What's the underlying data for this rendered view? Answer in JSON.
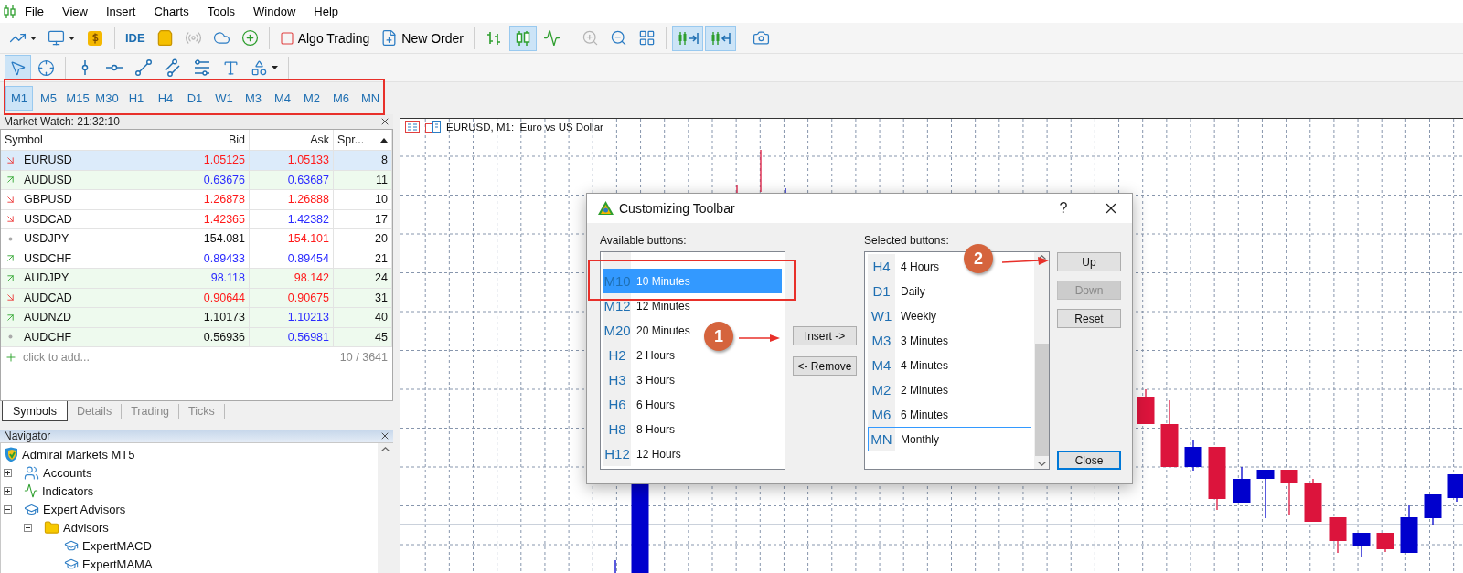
{
  "menu": [
    "File",
    "View",
    "Insert",
    "Charts",
    "Tools",
    "Window",
    "Help"
  ],
  "main_toolbar": {
    "ide": "IDE",
    "algo_trading": "Algo Trading",
    "new_order": "New Order",
    "signals_disabled": true,
    "bar_chart_selected": false,
    "candle_chart_selected": true,
    "line_chart_selected": false,
    "zoom_in_disabled": true,
    "chart_shift_on": true,
    "autoscroll_on": true
  },
  "drawing_toolbar": {
    "cursor_selected": true,
    "crosshair_selected": false
  },
  "timeframes": [
    {
      "label": "M1",
      "selected": true
    },
    {
      "label": "M5",
      "selected": false
    },
    {
      "label": "M15",
      "selected": false
    },
    {
      "label": "M30",
      "selected": false
    },
    {
      "label": "H1",
      "selected": false
    },
    {
      "label": "H4",
      "selected": false
    },
    {
      "label": "D1",
      "selected": false
    },
    {
      "label": "W1",
      "selected": false
    },
    {
      "label": "M3",
      "selected": false
    },
    {
      "label": "M4",
      "selected": false
    },
    {
      "label": "M2",
      "selected": false
    },
    {
      "label": "M6",
      "selected": false
    },
    {
      "label": "MN",
      "selected": false
    }
  ],
  "market_watch": {
    "title": "Market Watch: 21:32:10",
    "columns": [
      "Symbol",
      "Bid",
      "Ask",
      "Spr..."
    ],
    "rows": [
      {
        "kind": "down",
        "symbol": "EURUSD",
        "bid": {
          "value": "1.05125",
          "color": "#ff1a1a"
        },
        "ask": {
          "value": "1.05133",
          "color": "#ff1a1a"
        },
        "spread": "8",
        "selected": true
      },
      {
        "kind": "up",
        "symbol": "AUDUSD",
        "bid": {
          "value": "0.63676",
          "color": "#2b2bff"
        },
        "ask": {
          "value": "0.63687",
          "color": "#2b2bff"
        },
        "spread": "11",
        "selected": false,
        "shaded": true
      },
      {
        "kind": "down",
        "symbol": "GBPUSD",
        "bid": {
          "value": "1.26878",
          "color": "#ff1a1a"
        },
        "ask": {
          "value": "1.26888",
          "color": "#ff1a1a"
        },
        "spread": "10",
        "selected": false,
        "shaded": false
      },
      {
        "kind": "down",
        "symbol": "USDCAD",
        "bid": {
          "value": "1.42365",
          "color": "#ff1a1a"
        },
        "ask": {
          "value": "1.42382",
          "color": "#2b2bff"
        },
        "spread": "17",
        "selected": false,
        "shaded": false
      },
      {
        "kind": "flat",
        "symbol": "USDJPY",
        "bid": {
          "value": "154.081",
          "color": "#111111"
        },
        "ask": {
          "value": "154.101",
          "color": "#ff1a1a"
        },
        "spread": "20",
        "selected": false,
        "shaded": false
      },
      {
        "kind": "up",
        "symbol": "USDCHF",
        "bid": {
          "value": "0.89433",
          "color": "#2b2bff"
        },
        "ask": {
          "value": "0.89454",
          "color": "#2b2bff"
        },
        "spread": "21",
        "selected": false,
        "shaded": false
      },
      {
        "kind": "up",
        "symbol": "AUDJPY",
        "bid": {
          "value": "98.118",
          "color": "#2b2bff"
        },
        "ask": {
          "value": "98.142",
          "color": "#ff1a1a"
        },
        "spread": "24",
        "selected": false,
        "shaded": true
      },
      {
        "kind": "down",
        "symbol": "AUDCAD",
        "bid": {
          "value": "0.90644",
          "color": "#ff1a1a"
        },
        "ask": {
          "value": "0.90675",
          "color": "#ff1a1a"
        },
        "spread": "31",
        "selected": false,
        "shaded": true
      },
      {
        "kind": "up",
        "symbol": "AUDNZD",
        "bid": {
          "value": "1.10173",
          "color": "#111111"
        },
        "ask": {
          "value": "1.10213",
          "color": "#2b2bff"
        },
        "spread": "40",
        "selected": false,
        "shaded": true
      },
      {
        "kind": "flat",
        "symbol": "AUDCHF",
        "bid": {
          "value": "0.56936",
          "color": "#111111"
        },
        "ask": {
          "value": "0.56981",
          "color": "#2b2bff"
        },
        "spread": "45",
        "selected": false,
        "shaded": true
      }
    ],
    "add_row": "click to add...",
    "count": "10 / 3641",
    "tabs": [
      {
        "label": "Symbols",
        "selected": true
      },
      {
        "label": "Details",
        "selected": false
      },
      {
        "label": "Trading",
        "selected": false
      },
      {
        "label": "Ticks",
        "selected": false
      }
    ]
  },
  "navigator": {
    "title": "Navigator",
    "tree": [
      {
        "label": "Admiral Markets MT5",
        "kind": "root",
        "children": [
          {
            "label": "Accounts",
            "kind": "accounts",
            "expanded": false
          },
          {
            "label": "Indicators",
            "kind": "indicators",
            "expanded": false
          },
          {
            "label": "Expert Advisors",
            "kind": "experts",
            "expanded": true,
            "children": [
              {
                "label": "Advisors",
                "kind": "folder",
                "expanded": true,
                "children": [
                  {
                    "label": "ExpertMACD",
                    "kind": "expert"
                  },
                  {
                    "label": "ExpertMAMA",
                    "kind": "expert"
                  }
                ]
              }
            ]
          }
        ]
      }
    ]
  },
  "chart": {
    "title": "EURUSD, M1:  Euro vs US Dollar"
  },
  "dialog": {
    "title": "Customizing Toolbar",
    "help": "?",
    "available_label": "Available buttons:",
    "selected_label": "Selected buttons:",
    "available": [
      {
        "code": "M10",
        "label": "10 Minutes",
        "selected": true
      },
      {
        "code": "M12",
        "label": "12 Minutes",
        "selected": false
      },
      {
        "code": "M20",
        "label": "20 Minutes",
        "selected": false
      },
      {
        "code": "H2",
        "label": "2 Hours",
        "selected": false
      },
      {
        "code": "H3",
        "label": "3 Hours",
        "selected": false
      },
      {
        "code": "H6",
        "label": "6 Hours",
        "selected": false
      },
      {
        "code": "H8",
        "label": "8 Hours",
        "selected": false
      },
      {
        "code": "H12",
        "label": "12 Hours",
        "selected": false
      }
    ],
    "chosen": [
      {
        "code": "H4",
        "label": "4 Hours",
        "selected": false
      },
      {
        "code": "D1",
        "label": "Daily",
        "selected": false
      },
      {
        "code": "W1",
        "label": "Weekly",
        "selected": false
      },
      {
        "code": "M3",
        "label": "3 Minutes",
        "selected": false
      },
      {
        "code": "M4",
        "label": "4 Minutes",
        "selected": false
      },
      {
        "code": "M2",
        "label": "2 Minutes",
        "selected": false
      },
      {
        "code": "M6",
        "label": "6 Minutes",
        "selected": false
      },
      {
        "code": "MN",
        "label": "Monthly",
        "selected": true
      }
    ],
    "insert": "Insert ->",
    "remove": "<- Remove",
    "side_buttons": [
      {
        "label": "Up",
        "disabled": false
      },
      {
        "label": "Down",
        "disabled": true
      },
      {
        "label": "Reset",
        "disabled": false
      }
    ],
    "close": "Close"
  },
  "annotations": [
    {
      "label": "1"
    },
    {
      "label": "2"
    }
  ]
}
